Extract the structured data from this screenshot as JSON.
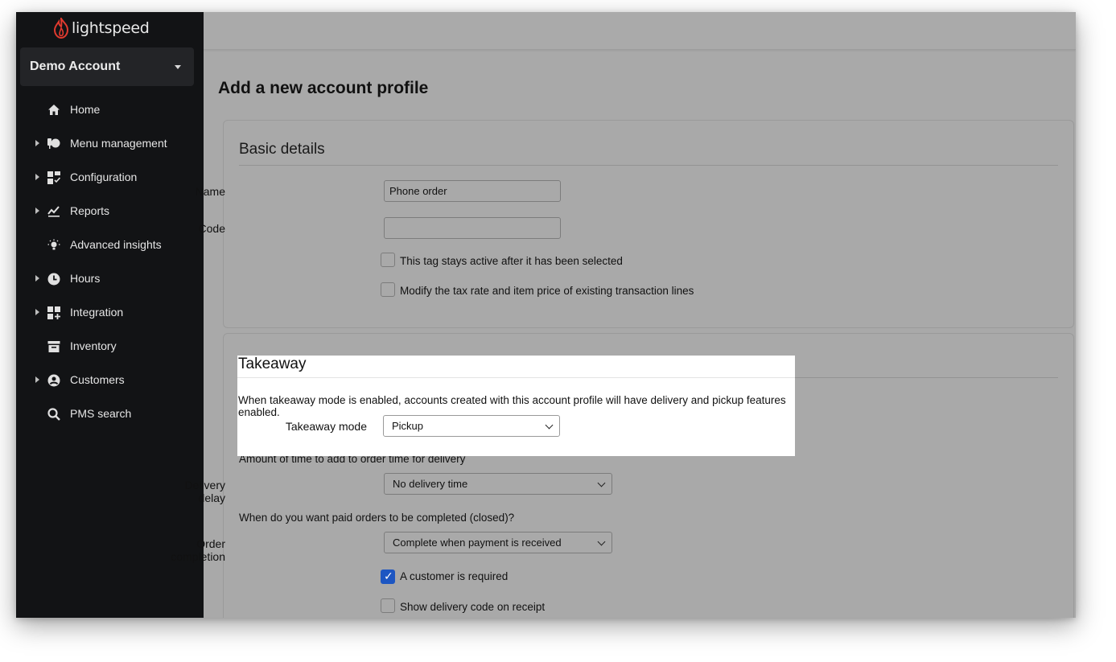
{
  "brand": {
    "name": "lightspeed",
    "logo_color": "#e03a2f"
  },
  "account": {
    "name": "Demo Account"
  },
  "nav": [
    {
      "label": "Home",
      "icon": "home-icon",
      "expandable": false
    },
    {
      "label": "Menu management",
      "icon": "menu-management-icon",
      "expandable": true
    },
    {
      "label": "Configuration",
      "icon": "configuration-icon",
      "expandable": true
    },
    {
      "label": "Reports",
      "icon": "reports-icon",
      "expandable": true
    },
    {
      "label": "Advanced insights",
      "icon": "lightbulb-icon",
      "expandable": false
    },
    {
      "label": "Hours",
      "icon": "clock-icon",
      "expandable": true
    },
    {
      "label": "Integration",
      "icon": "integration-icon",
      "expandable": true
    },
    {
      "label": "Inventory",
      "icon": "inventory-icon",
      "expandable": false
    },
    {
      "label": "Customers",
      "icon": "customer-icon",
      "expandable": true
    },
    {
      "label": "PMS search",
      "icon": "search-icon",
      "expandable": false
    }
  ],
  "page": {
    "title": "Add a new account profile"
  },
  "basic": {
    "title": "Basic details",
    "name_label": "Name",
    "name_value": "Phone order",
    "code_label": "Code",
    "code_value": "",
    "sticky_tag_label": "This tag stays active after it has been selected",
    "sticky_tag_checked": false,
    "modify_tax_label": "Modify the tax rate and item price of existing transaction lines",
    "modify_tax_checked": false
  },
  "takeaway": {
    "title": "Takeaway",
    "help": "When takeaway mode is enabled, accounts created with this account profile will have delivery and pickup features enabled.",
    "mode_label": "Takeaway mode",
    "mode_value": "Pickup",
    "delay_help": "Amount of time to add to order time for delivery",
    "delay_label": "Delivery delay",
    "delay_value": "No delivery time",
    "completion_help": "When do you want paid orders to be completed (closed)?",
    "completion_label": "Order completion",
    "completion_value": "Complete when payment is received",
    "customer_required_label": "A customer is required",
    "customer_required_checked": true,
    "delivery_code_label": "Show delivery code on receipt",
    "delivery_code_checked": false
  }
}
